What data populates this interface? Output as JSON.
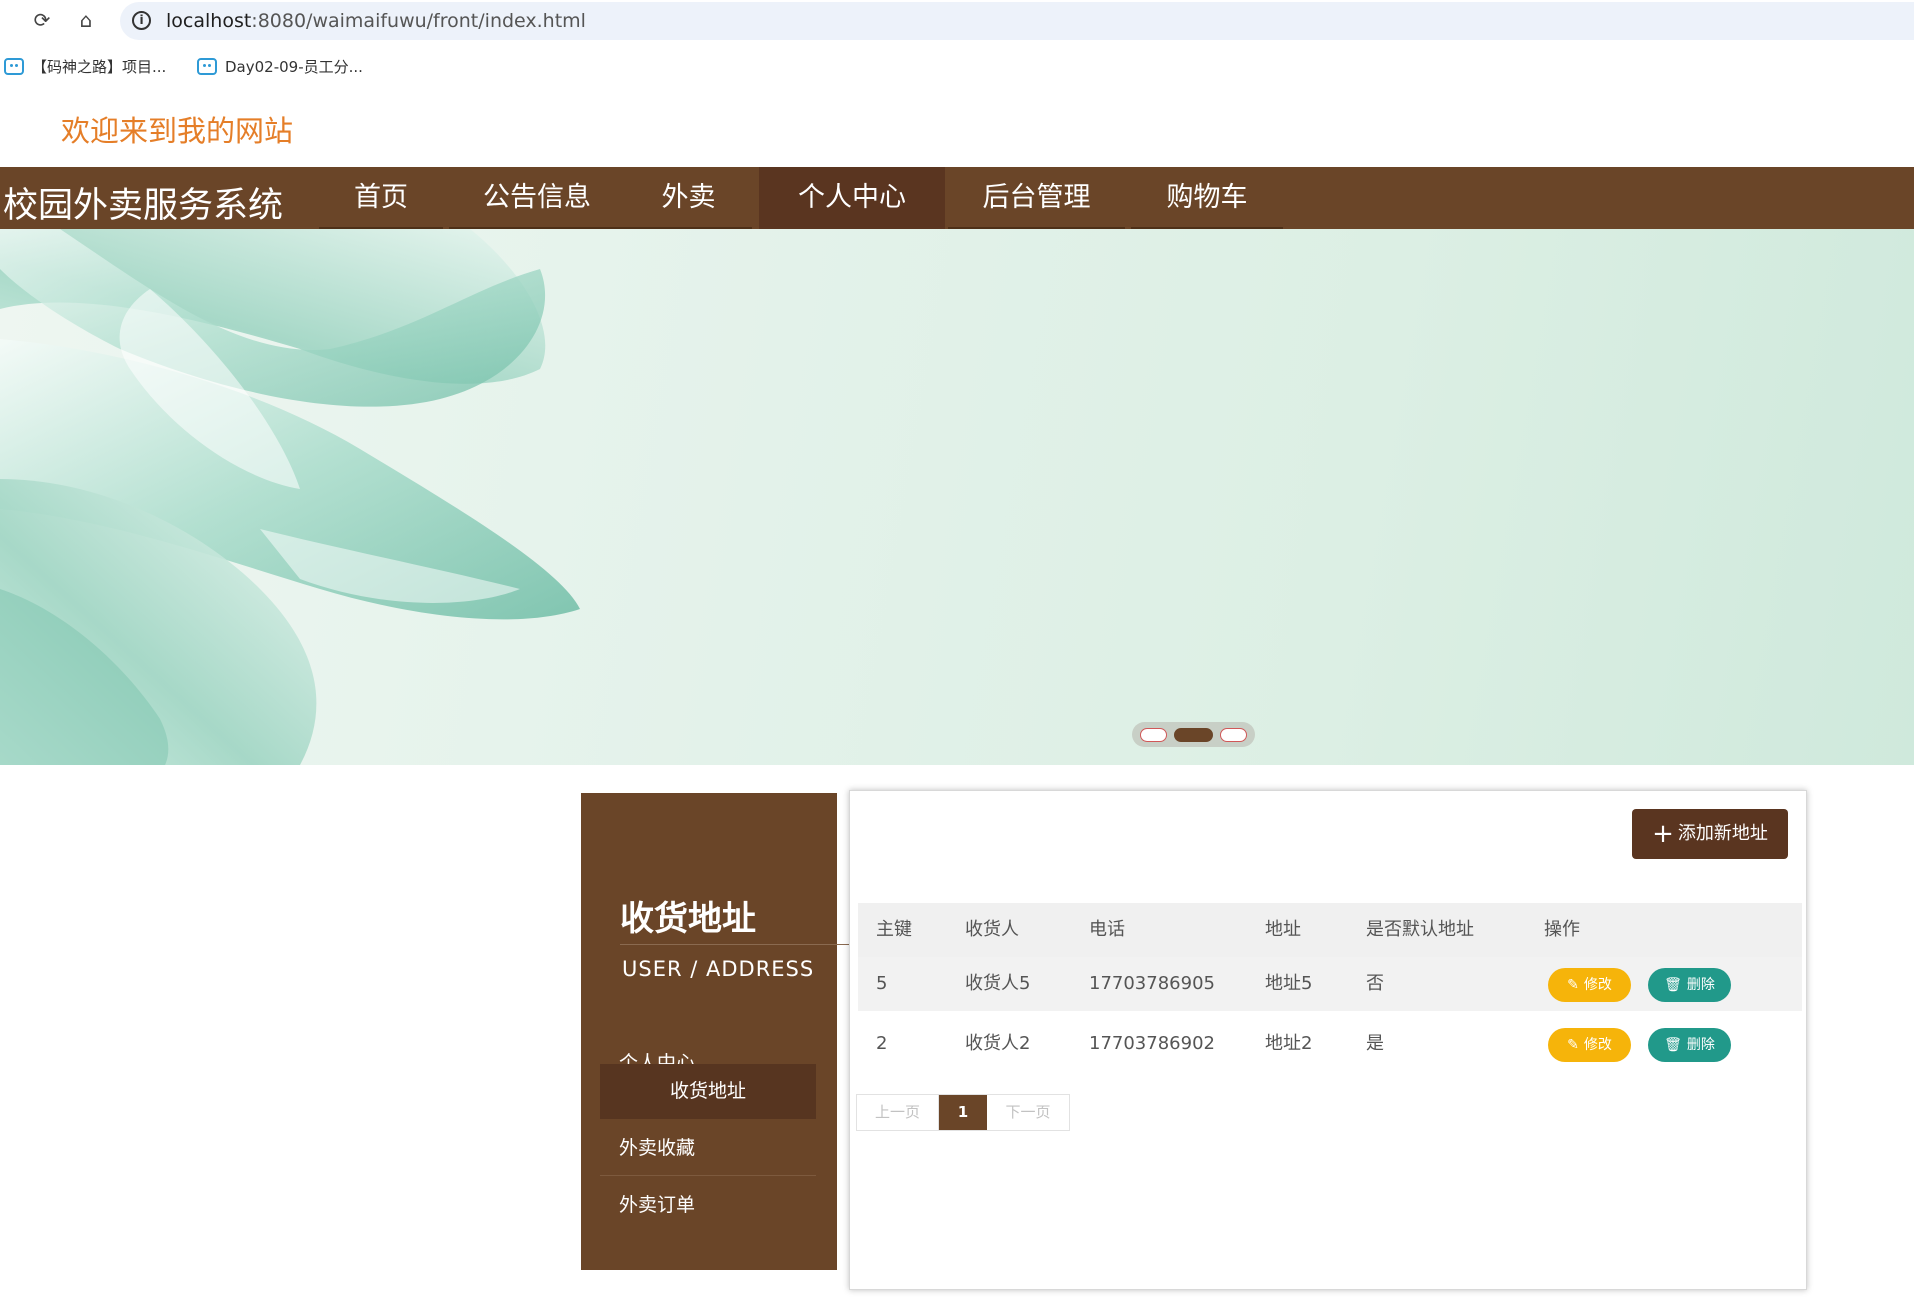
{
  "browser": {
    "url_host": "localhost",
    "url_path": ":8080/waimaifuwu/front/index.html",
    "bookmarks": [
      "【码神之路】项目...",
      "Day02-09-员工分..."
    ]
  },
  "site": {
    "welcome": "欢迎来到我的网站",
    "brand": "校园外卖服务系统",
    "nav": [
      "首页",
      "公告信息",
      "外卖",
      "个人中心",
      "后台管理",
      "购物车"
    ],
    "nav_active": "个人中心"
  },
  "banner": {
    "slides": 3,
    "active_slide": 2
  },
  "sidebar": {
    "title": "收货地址",
    "subtitle": "USER / ADDRESS",
    "items": [
      "个人中心",
      "收货地址",
      "外卖收藏",
      "外卖订单"
    ],
    "active": "收货地址"
  },
  "content": {
    "add_button": "添加新地址",
    "columns": [
      "主键",
      "收货人",
      "电话",
      "地址",
      "是否默认地址",
      "操作"
    ],
    "rows": [
      {
        "id": "5",
        "name": "收货人5",
        "phone": "17703786905",
        "address": "地址5",
        "default": "否"
      },
      {
        "id": "2",
        "name": "收货人2",
        "phone": "17703786902",
        "address": "地址2",
        "default": "是"
      }
    ],
    "edit_label": "修改",
    "delete_label": "删除",
    "pager": {
      "prev": "上一页",
      "current": "1",
      "next": "下一页"
    }
  },
  "colors": {
    "brand_brown": "#6a4528",
    "accent_orange": "#e57e28",
    "edit_yellow": "#f6b40a",
    "delete_teal": "#21998a"
  }
}
